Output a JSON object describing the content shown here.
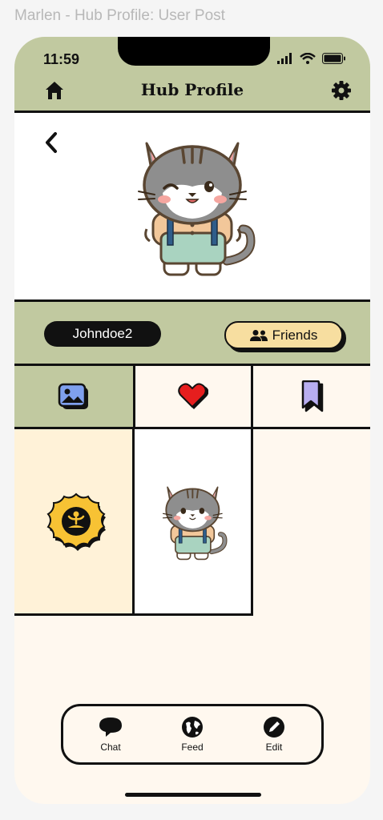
{
  "window_title": "Marlen - Hub Profile: User Post",
  "status_bar": {
    "time": "11:59"
  },
  "header": {
    "title": "Hub Profile",
    "home_icon": "home-icon",
    "settings_icon": "gear-icon"
  },
  "hero": {
    "back_icon": "chevron-left-icon",
    "avatar": "cat-avatar"
  },
  "profile_bar": {
    "username": "Johndoe2",
    "friends_label": "Friends",
    "friends_icon": "people-icon"
  },
  "tabs": [
    {
      "icon": "image-icon",
      "active": true
    },
    {
      "icon": "heart-icon",
      "active": false
    },
    {
      "icon": "bookmark-icon",
      "active": false
    }
  ],
  "grid": [
    {
      "type": "badge",
      "icon": "meditation-badge-icon"
    },
    {
      "type": "post",
      "image": "cat-image"
    }
  ],
  "bottom_nav": [
    {
      "label": "Chat",
      "icon": "chat-bubble-icon"
    },
    {
      "label": "Feed",
      "icon": "globe-icon"
    },
    {
      "label": "Edit",
      "icon": "pencil-icon"
    }
  ],
  "colors": {
    "sage": "#c1c9a0",
    "cream": "#fff8ef",
    "peach": "#f7dea0",
    "ink": "#111111",
    "badge_yellow": "#f7c234"
  }
}
